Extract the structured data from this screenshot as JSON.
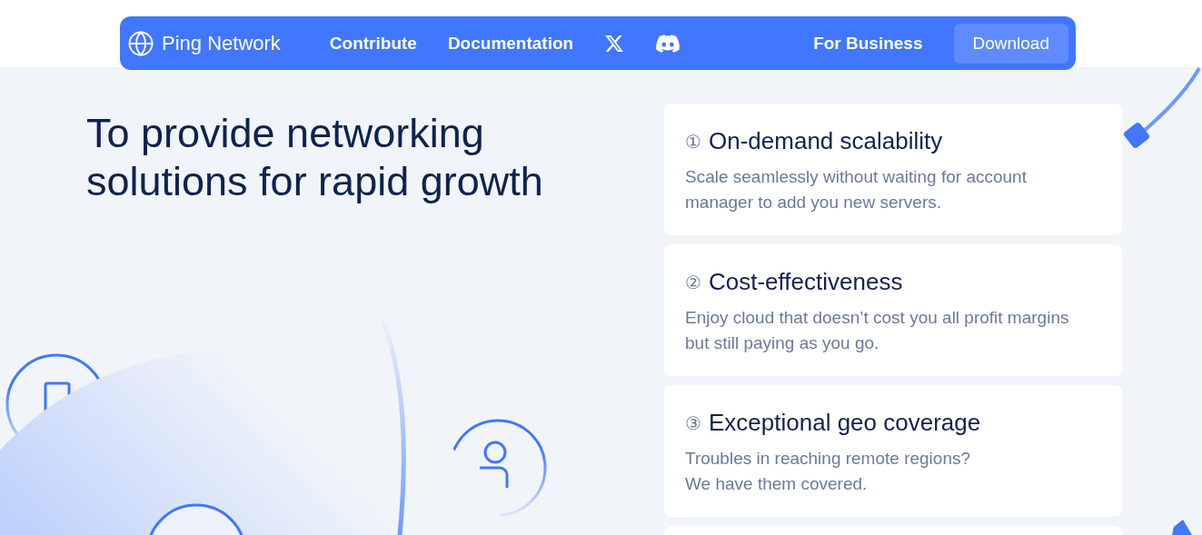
{
  "nav": {
    "brand": "Ping Network",
    "links": [
      {
        "kind": "text",
        "label": "Contribute"
      },
      {
        "kind": "text",
        "label": "Documentation"
      },
      {
        "kind": "x"
      },
      {
        "kind": "discord"
      }
    ],
    "business": "For Business",
    "download": "Download"
  },
  "hero": {
    "heading": "To provide networking solutions for rapid growth"
  },
  "features": [
    {
      "kind": "full",
      "number": "①",
      "title": "On-demand scalability",
      "text": "Scale seamlessly without waiting for account manager to add you new servers."
    },
    {
      "kind": "full",
      "number": "②",
      "title": "Cost-effectiveness",
      "text": "Enjoy cloud that doesn’t cost you all profit margins but still paying as you go."
    },
    {
      "kind": "full",
      "number": "③",
      "title": "Exceptional geo coverage",
      "text": "Troubles in reaching remote regions?\nWe have them covered."
    },
    {
      "kind": "partial"
    }
  ]
}
